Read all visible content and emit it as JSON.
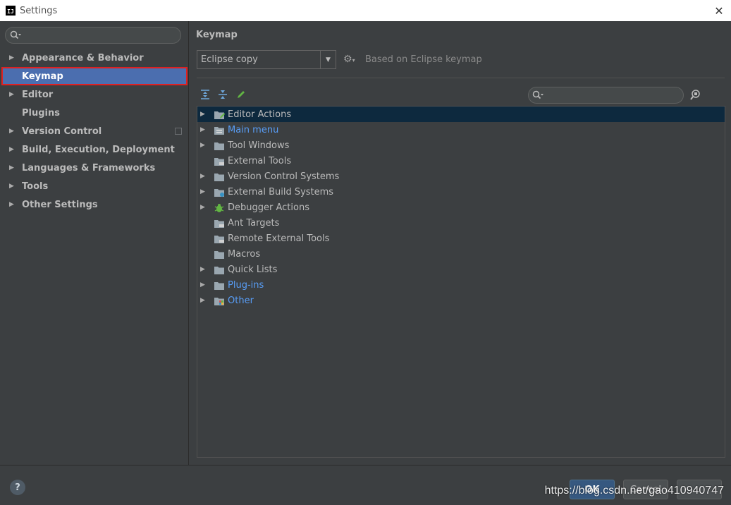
{
  "window": {
    "app_icon_text": "IJ",
    "title": "Settings"
  },
  "sidebar": {
    "search_placeholder": "",
    "items": [
      {
        "label": "Appearance & Behavior",
        "expandable": true
      },
      {
        "label": "Keymap",
        "expandable": false,
        "selected": true
      },
      {
        "label": "Editor",
        "expandable": true
      },
      {
        "label": "Plugins",
        "expandable": false
      },
      {
        "label": "Version Control",
        "expandable": true
      },
      {
        "label": "Build, Execution, Deployment",
        "expandable": true
      },
      {
        "label": "Languages & Frameworks",
        "expandable": true
      },
      {
        "label": "Tools",
        "expandable": true
      },
      {
        "label": "Other Settings",
        "expandable": true
      }
    ]
  },
  "main": {
    "title": "Keymap",
    "keymap_select": {
      "value": "Eclipse copy"
    },
    "based_on": "Based on Eclipse keymap",
    "tree": [
      {
        "label": "Editor Actions",
        "expandable": true,
        "color": "default",
        "icon": "editor-actions-folder-icon",
        "selected": true
      },
      {
        "label": "Main menu",
        "expandable": true,
        "color": "blue",
        "icon": "main-menu-folder-icon"
      },
      {
        "label": "Tool Windows",
        "expandable": true,
        "color": "default",
        "icon": "folder-icon"
      },
      {
        "label": "External Tools",
        "expandable": false,
        "color": "default",
        "icon": "tools-folder-icon"
      },
      {
        "label": "Version Control Systems",
        "expandable": true,
        "color": "default",
        "icon": "folder-icon"
      },
      {
        "label": "External Build Systems",
        "expandable": true,
        "color": "default",
        "icon": "build-folder-icon"
      },
      {
        "label": "Debugger Actions",
        "expandable": true,
        "color": "default",
        "icon": "bug-icon"
      },
      {
        "label": "Ant Targets",
        "expandable": false,
        "color": "default",
        "icon": "ant-folder-icon"
      },
      {
        "label": "Remote External Tools",
        "expandable": false,
        "color": "default",
        "icon": "tools-folder-icon"
      },
      {
        "label": "Macros",
        "expandable": false,
        "color": "default",
        "icon": "folder-icon"
      },
      {
        "label": "Quick Lists",
        "expandable": true,
        "color": "default",
        "icon": "folder-icon"
      },
      {
        "label": "Plug-ins",
        "expandable": true,
        "color": "blue",
        "icon": "folder-icon"
      },
      {
        "label": "Other",
        "expandable": true,
        "color": "blue",
        "icon": "other-folder-icon"
      }
    ]
  },
  "footer": {
    "help": "?",
    "ok": "OK",
    "cancel": "Cancel",
    "apply": "",
    "watermark": "https://blog.csdn.net/gao410940747"
  },
  "colors": {
    "background": "#3c3f41",
    "selection": "#4b6eaf",
    "highlight_border": "#e02020",
    "tree_selection": "#0d293e",
    "link_blue": "#589df6"
  }
}
